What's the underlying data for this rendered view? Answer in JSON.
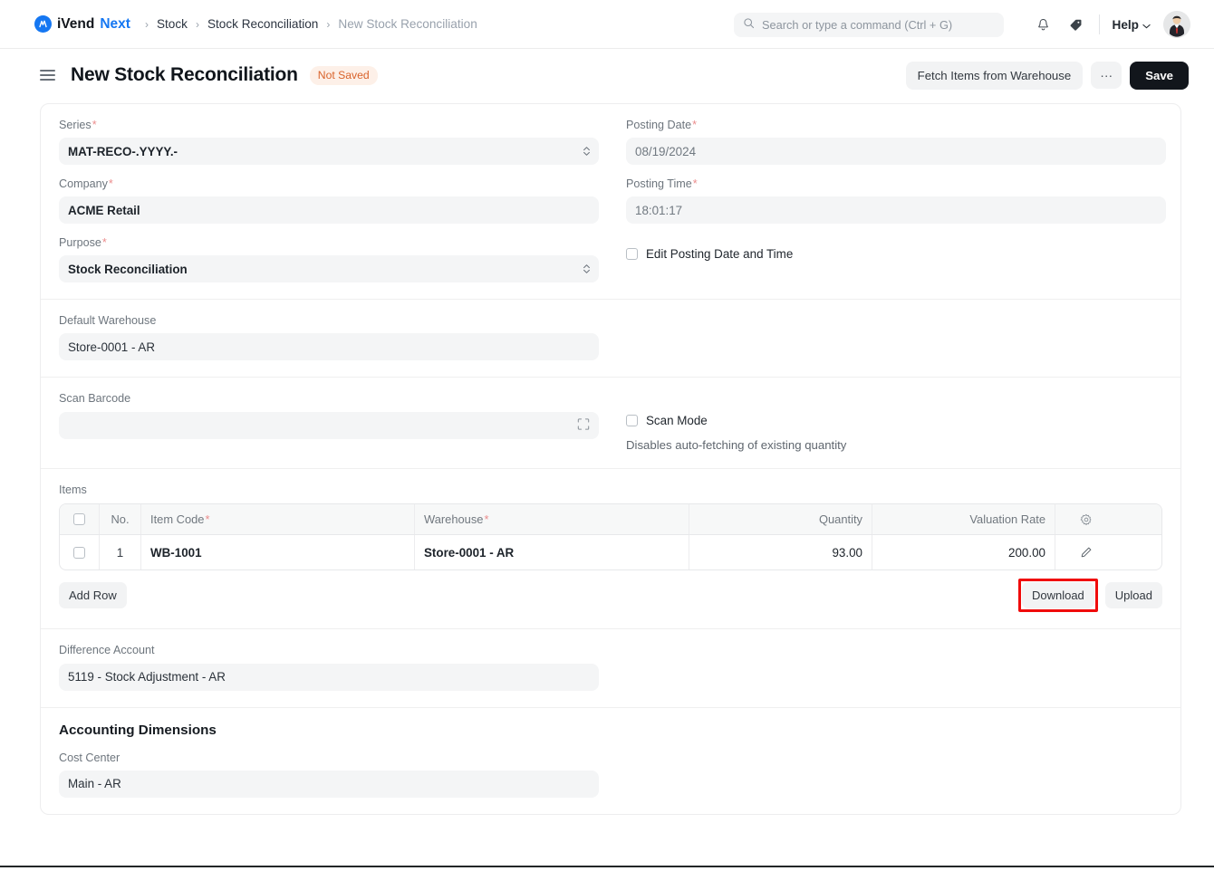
{
  "navbar": {
    "brand": {
      "mark": "logo-icon",
      "part1": "iVend",
      "part2": "Next"
    },
    "breadcrumbs": [
      {
        "label": "Stock",
        "muted": false
      },
      {
        "label": "Stock Reconciliation",
        "muted": false
      },
      {
        "label": "New Stock Reconciliation",
        "muted": true
      }
    ],
    "separator": "›",
    "search": {
      "placeholder": "Search or type a command (Ctrl + G)",
      "value": ""
    },
    "notifications_icon": "bell-icon",
    "tag_icon": "tag-icon",
    "help_label": "Help",
    "help_caret": "⌄",
    "avatar_alt": "user-avatar"
  },
  "page_header": {
    "menu_icon": "hamburger-icon",
    "title": "New Stock Reconciliation",
    "status_badge": "Not Saved",
    "fetch_button": "Fetch Items from Warehouse",
    "more_button": "···",
    "save_button": "Save"
  },
  "form": {
    "series": {
      "label": "Series",
      "required": true,
      "value": "MAT-RECO-.YYYY.-"
    },
    "company": {
      "label": "Company",
      "required": true,
      "value": "ACME Retail"
    },
    "purpose": {
      "label": "Purpose",
      "required": true,
      "value": "Stock Reconciliation"
    },
    "posting_date": {
      "label": "Posting Date",
      "required": true,
      "value": "08/19/2024"
    },
    "posting_time": {
      "label": "Posting Time",
      "required": true,
      "value": "18:01:17"
    },
    "edit_posting": {
      "label": "Edit Posting Date and Time",
      "checked": false
    },
    "default_warehouse": {
      "label": "Default Warehouse",
      "required": false,
      "value": "Store-0001 - AR"
    },
    "scan_barcode": {
      "label": "Scan Barcode",
      "required": false,
      "value": "",
      "icon": "scan-icon"
    },
    "scan_mode": {
      "label": "Scan Mode",
      "checked": false,
      "hint": "Disables auto-fetching of existing quantity"
    },
    "difference_account": {
      "label": "Difference Account",
      "required": false,
      "value": "5119 - Stock Adjustment - AR"
    },
    "cost_center": {
      "label": "Cost Center",
      "required": false,
      "value": "Main - AR"
    }
  },
  "items": {
    "label": "Items",
    "columns": [
      {
        "key": "select",
        "label": "",
        "required": false
      },
      {
        "key": "no",
        "label": "No.",
        "required": false
      },
      {
        "key": "item_code",
        "label": "Item Code",
        "required": true
      },
      {
        "key": "warehouse",
        "label": "Warehouse",
        "required": true
      },
      {
        "key": "quantity",
        "label": "Quantity",
        "required": false
      },
      {
        "key": "valuation_rate",
        "label": "Valuation Rate",
        "required": false
      },
      {
        "key": "settings",
        "label": "",
        "required": false
      }
    ],
    "rows": [
      {
        "no": "1",
        "item_code": "WB-1001",
        "warehouse": "Store-0001 - AR",
        "quantity": "93.00",
        "valuation_rate": "200.00"
      }
    ],
    "settings_icon": "gear-icon",
    "row_edit_icon": "pencil-icon",
    "add_row_button": "Add Row",
    "download_button": "Download",
    "upload_button": "Upload"
  },
  "accounting_dimensions": {
    "title": "Accounting Dimensions"
  },
  "annotation": {
    "target": "download-button",
    "color": "#f00b0b"
  }
}
